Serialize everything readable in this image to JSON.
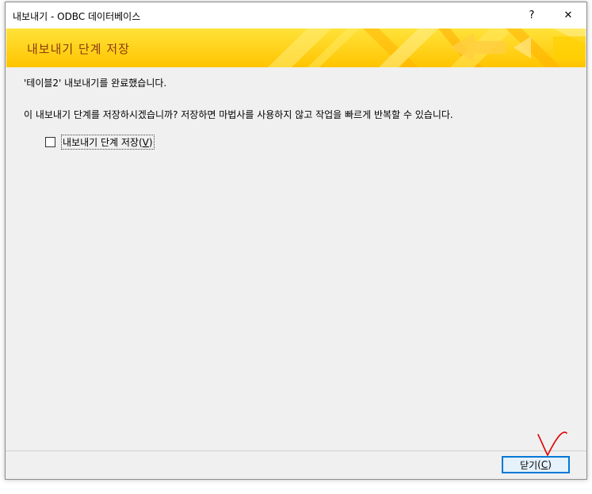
{
  "window": {
    "title": "내보내기 - ODBC 데이터베이스",
    "help_glyph": "?",
    "close_glyph": "✕"
  },
  "banner": {
    "title": "내보내기 단계 저장"
  },
  "body": {
    "completion_message": "'테이블2' 내보내기를 완료했습니다.",
    "save_prompt": "이 내보내기 단계를 저장하시겠습니까? 저장하면 마법사를 사용하지 않고 작업을 빠르게 반복할 수 있습니다.",
    "save_steps_checkbox": {
      "label": "내보내기 단계 저장",
      "accel_open": "(",
      "accel_key": "V",
      "accel_close": ")",
      "checked": false
    }
  },
  "footer": {
    "close_button": {
      "label": "닫기",
      "accel_open": "(",
      "accel_key": "C",
      "accel_close": ")"
    }
  },
  "colors": {
    "banner_bg": "#ffd60a",
    "banner_title": "#8a3a0e",
    "focus_border": "#0078d7",
    "annotation_red": "#e00000"
  },
  "icons": {
    "help": "question-mark-icon",
    "close": "close-icon"
  }
}
